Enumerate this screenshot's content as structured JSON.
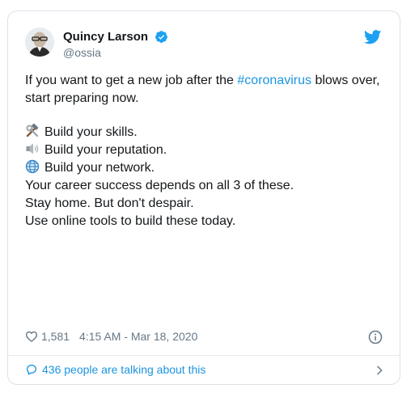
{
  "author": {
    "name": "Quincy Larson",
    "handle": "@ossia",
    "verified": true,
    "avatar": "person-with-glasses-avatar"
  },
  "brand": {
    "icon": "twitter-bird-icon",
    "color": "#1da1f2",
    "link_color": "#1b95e0"
  },
  "tweet": {
    "intro_before": "If you want to get a new job after the ",
    "hashtag": "#coronavirus",
    "intro_after": " blows over, start preparing now.",
    "items": [
      {
        "icon": "hammer-and-wrench-emoji",
        "text": "Build your skills."
      },
      {
        "icon": "speaker-emoji",
        "text": "Build your reputation."
      },
      {
        "icon": "globe-emoji",
        "text": "Build your network."
      }
    ],
    "line_career": "Your career success depends on all 3 of these.",
    "line_stay": "Stay home. But don't despair.",
    "line_tools": "Use online tools to build these today."
  },
  "meta": {
    "likes": "1,581",
    "timestamp": "4:15 AM - Mar 18, 2020"
  },
  "footer": {
    "talking": "436 people are talking about this"
  }
}
